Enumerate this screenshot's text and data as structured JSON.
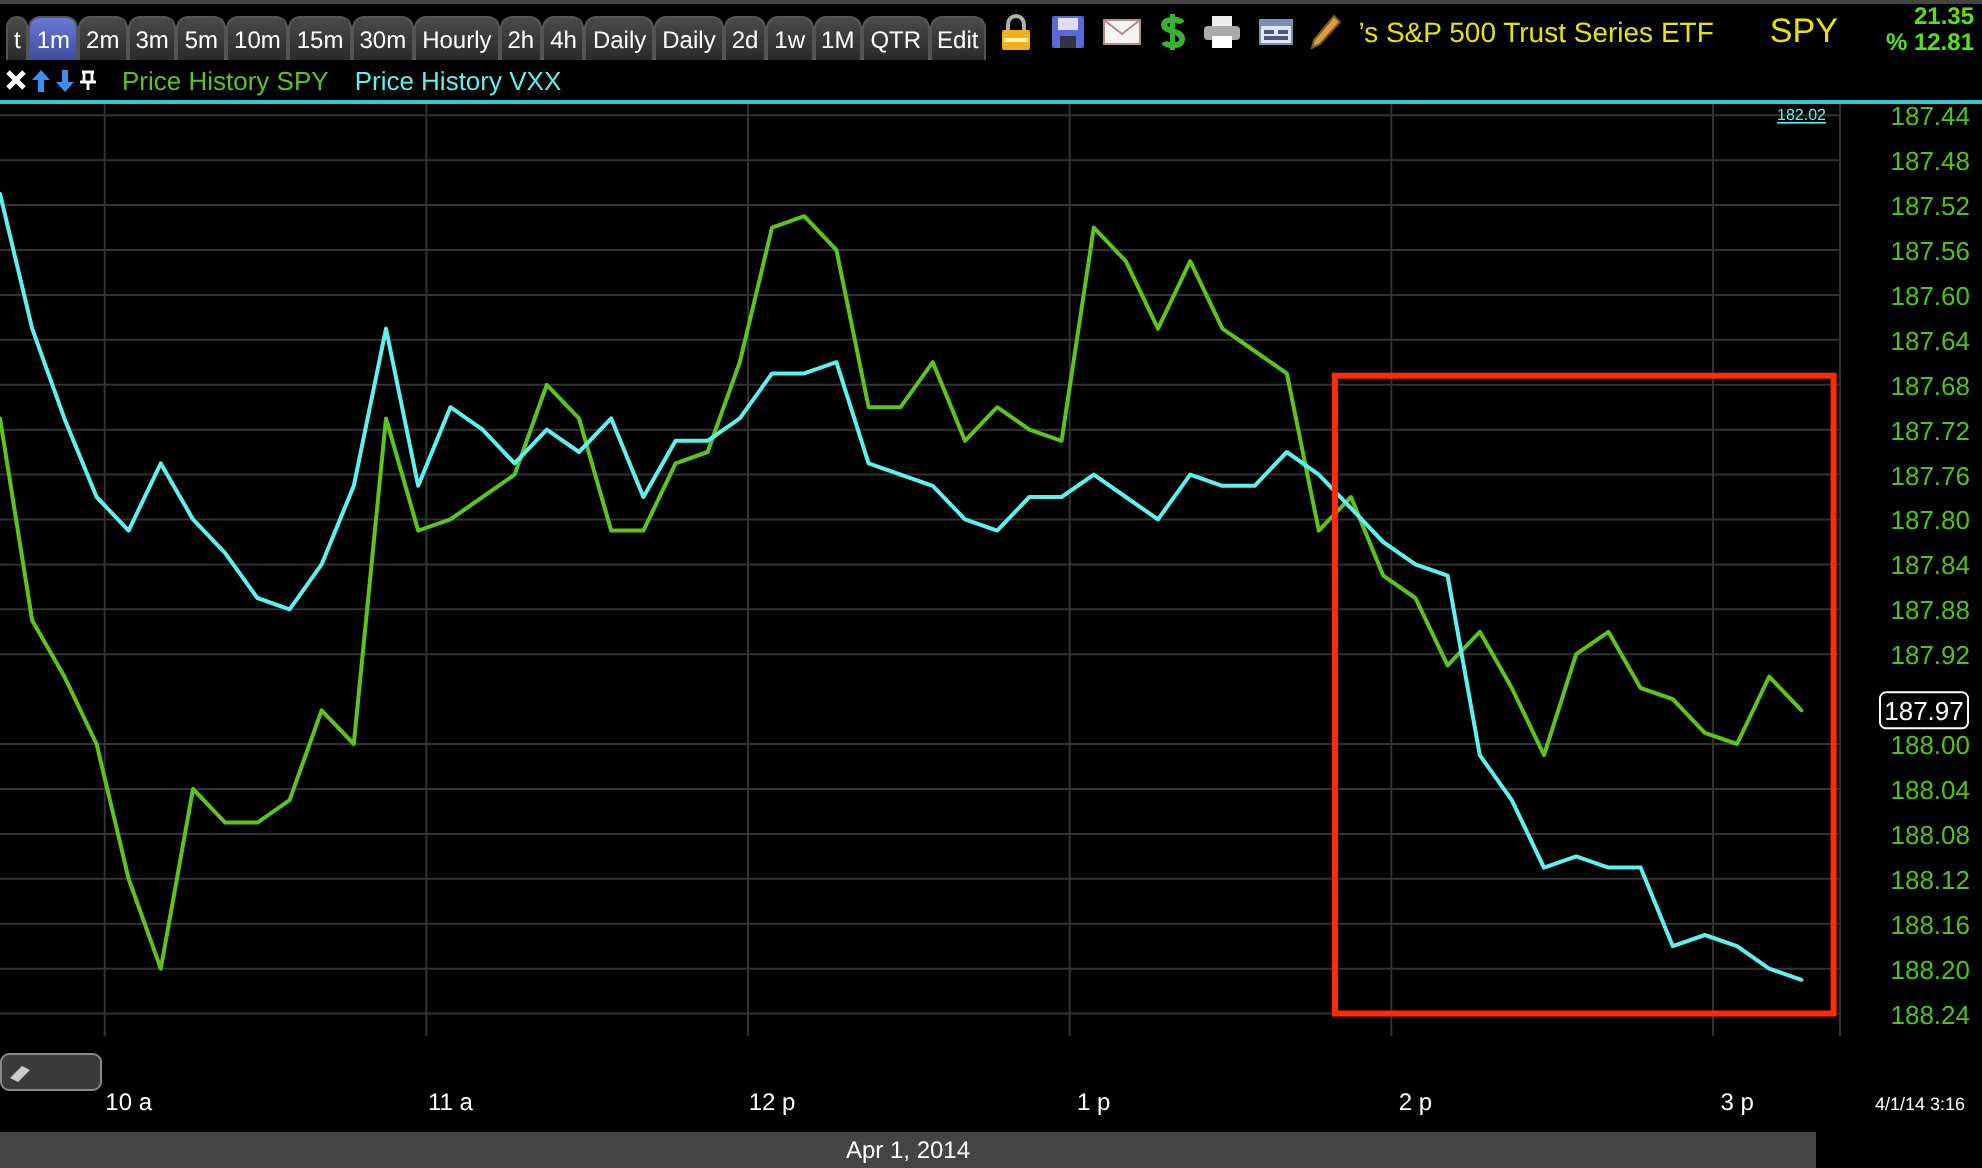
{
  "toolbar": {
    "tabs": [
      {
        "label": "t",
        "selected": false
      },
      {
        "label": "1m",
        "selected": true
      },
      {
        "label": "2m",
        "selected": false
      },
      {
        "label": "3m",
        "selected": false
      },
      {
        "label": "5m",
        "selected": false
      },
      {
        "label": "10m",
        "selected": false
      },
      {
        "label": "15m",
        "selected": false
      },
      {
        "label": "30m",
        "selected": false
      },
      {
        "label": "Hourly",
        "selected": false
      },
      {
        "label": "2h",
        "selected": false
      },
      {
        "label": "4h",
        "selected": false
      },
      {
        "label": "Daily",
        "selected": false
      },
      {
        "label": "Daily",
        "selected": false
      },
      {
        "label": "2d",
        "selected": false
      },
      {
        "label": "1w",
        "selected": false
      },
      {
        "label": "1M",
        "selected": false
      },
      {
        "label": "QTR",
        "selected": false
      },
      {
        "label": "Edit",
        "selected": false
      }
    ],
    "title": "’s S&P 500 Trust Series ETF",
    "symbol": "SPY",
    "change": "21.35",
    "percent": "% 12.81"
  },
  "chart": {
    "vxx_marker": "182.02",
    "last_price": "187.97",
    "timestamp": "4/1/14 3:16",
    "date": "Apr 1, 2014",
    "chart_data": {
      "type": "line",
      "categories": [
        null,
        null,
        null,
        null,
        "10 a",
        null,
        null,
        null,
        null,
        null,
        null,
        null,
        null,
        null,
        "11 a",
        null,
        null,
        null,
        null,
        null,
        null,
        null,
        null,
        null,
        "12 p",
        null,
        null,
        null,
        null,
        null,
        null,
        null,
        null,
        null,
        "1 p",
        null,
        null,
        null,
        null,
        null,
        null,
        null,
        null,
        null,
        "2 p",
        null,
        null,
        null,
        null,
        null,
        null,
        null,
        null,
        null,
        "3 p",
        null,
        null
      ],
      "series": [
        {
          "name": "Price History SPY",
          "color": "#5cc41a",
          "values": [
            187.71,
            187.89,
            187.94,
            188.0,
            188.12,
            188.2,
            188.04,
            188.07,
            188.07,
            188.05,
            187.97,
            188.0,
            187.71,
            187.81,
            187.8,
            187.78,
            187.76,
            187.68,
            187.71,
            187.81,
            187.81,
            187.75,
            187.74,
            187.66,
            187.54,
            187.53,
            187.56,
            187.7,
            187.7,
            187.66,
            187.73,
            187.7,
            187.72,
            187.73,
            187.54,
            187.57,
            187.63,
            187.57,
            187.63,
            187.65,
            187.67,
            187.81,
            187.78,
            187.85,
            187.87,
            187.93,
            187.9,
            187.95,
            188.01,
            187.92,
            187.9,
            187.95,
            187.96,
            187.99,
            188.0,
            187.94,
            187.97
          ]
        },
        {
          "name": "Price History VXX",
          "color": "#5ff0f0",
          "values": [
            187.51,
            187.63,
            187.71,
            187.78,
            187.81,
            187.75,
            187.8,
            187.83,
            187.87,
            187.88,
            187.84,
            187.77,
            187.63,
            187.77,
            187.7,
            187.72,
            187.75,
            187.72,
            187.74,
            187.71,
            187.78,
            187.73,
            187.73,
            187.71,
            187.67,
            187.67,
            187.66,
            187.75,
            187.76,
            187.77,
            187.8,
            187.81,
            187.78,
            187.78,
            187.76,
            187.78,
            187.8,
            187.76,
            187.77,
            187.77,
            187.74,
            187.76,
            187.79,
            187.82,
            187.84,
            187.85,
            188.01,
            188.05,
            188.11,
            188.1,
            188.11,
            188.11,
            188.18,
            188.17,
            188.18,
            188.2,
            188.21
          ]
        }
      ],
      "ylim": [
        188.26,
        187.43
      ],
      "grid": true,
      "yticks": [
        {
          "value": 187.44,
          "label": "187.44"
        },
        {
          "value": 187.48,
          "label": "187.48"
        },
        {
          "value": 187.52,
          "label": "187.52"
        },
        {
          "value": 187.56,
          "label": "187.56"
        },
        {
          "value": 187.6,
          "label": "187.60"
        },
        {
          "value": 187.64,
          "label": "187.64"
        },
        {
          "value": 187.68,
          "label": "187.68"
        },
        {
          "value": 187.72,
          "label": "187.72"
        },
        {
          "value": 187.76,
          "label": "187.76"
        },
        {
          "value": 187.8,
          "label": "187.80"
        },
        {
          "value": 187.84,
          "label": "187.84"
        },
        {
          "value": 187.88,
          "label": "187.88"
        },
        {
          "value": 187.92,
          "label": "187.92"
        },
        {
          "value": 188.0,
          "label": "188.00"
        },
        {
          "value": 188.04,
          "label": "188.04"
        },
        {
          "value": 188.08,
          "label": "188.08"
        },
        {
          "value": 188.12,
          "label": "188.12"
        },
        {
          "value": 188.16,
          "label": "188.16"
        },
        {
          "value": 188.2,
          "label": "188.20"
        },
        {
          "value": 188.24,
          "label": "188.24"
        }
      ]
    }
  }
}
